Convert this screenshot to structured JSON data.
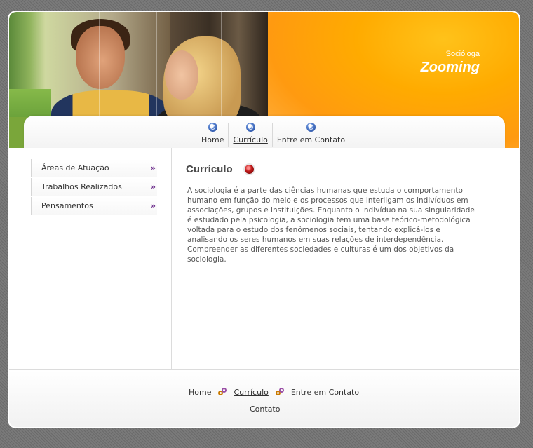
{
  "header": {
    "tagline": "Socióloga",
    "brand": "Zooming"
  },
  "nav": {
    "items": [
      {
        "label": "Home",
        "icon": "globe-icon",
        "active": false
      },
      {
        "label": "Currículo",
        "icon": "globe-icon",
        "active": true
      },
      {
        "label": "Entre em Contato",
        "icon": "globe-icon",
        "active": false
      }
    ]
  },
  "sidebar": {
    "items": [
      {
        "label": "Áreas de Atuação",
        "chevron": "»"
      },
      {
        "label": "Trabalhos Realizados",
        "chevron": "»"
      },
      {
        "label": "Pensamentos",
        "chevron": "»"
      }
    ]
  },
  "content": {
    "title": "Currículo",
    "title_icon": "red-bullet-icon",
    "body": "A sociologia é a parte das ciências humanas que estuda o comportamento humano em função do meio e os processos que interligam os indivíduos em associações, grupos e instituições. Enquanto o indivíduo na sua singularidade é estudado pela psicologia, a sociologia tem uma base teórico-metodológica voltada para o estudo dos fenômenos sociais, tentando explicá-los e analisando os seres humanos em suas relações de interdependência. Compreender as diferentes sociedades e culturas é um dos objetivos da sociologia."
  },
  "footer": {
    "links": [
      {
        "label": "Home",
        "active": false
      },
      {
        "label": "Currículo",
        "active": true
      },
      {
        "label": "Entre em Contato",
        "active": false
      }
    ],
    "separator_icon": "gender-icon",
    "contact": "Contato"
  },
  "colors": {
    "accent": "#ffab00",
    "background": "#6e6e6e",
    "chevron": "#6a2a8a"
  }
}
